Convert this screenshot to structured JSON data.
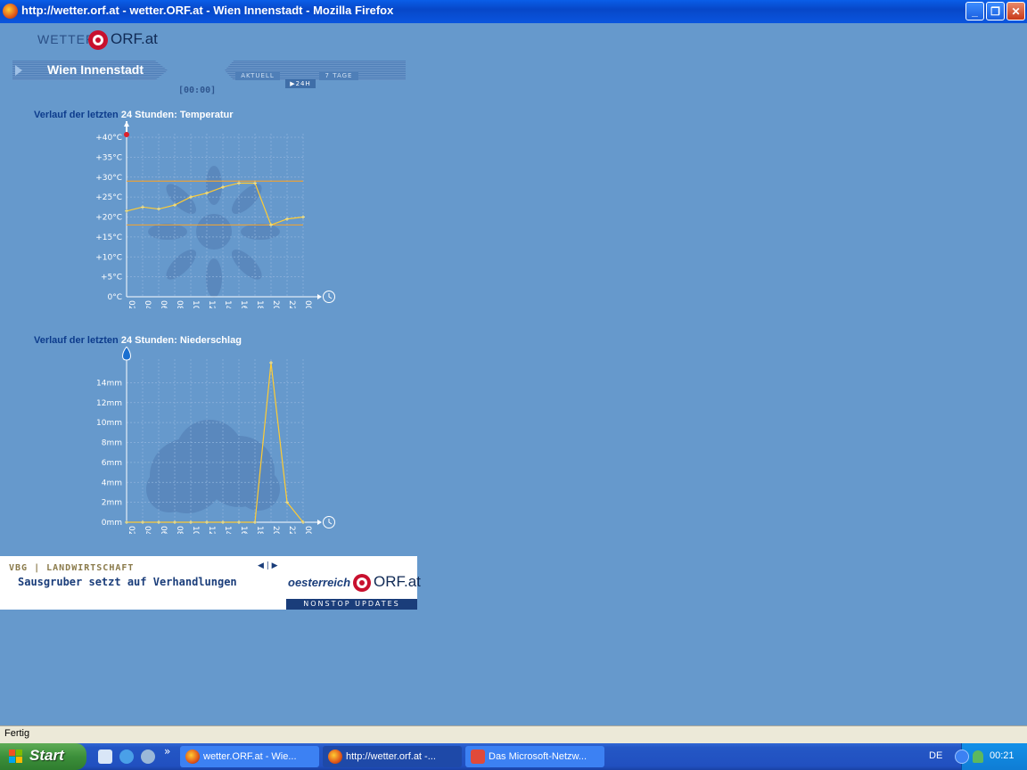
{
  "window": {
    "title": "http://wetter.orf.at - wetter.ORF.at - Wien Innenstadt - Mozilla Firefox",
    "min_glyph": "_",
    "max_glyph": "❐",
    "close_glyph": "✕"
  },
  "header": {
    "logo_wetter": "WETTER",
    "logo_orf": "ORF.at",
    "city": "Wien Innenstadt",
    "nav": {
      "aktuell": "AKTUELL",
      "h24": "▶24H",
      "tage7": "7 TAGE"
    },
    "time": "[00:00]"
  },
  "temperature": {
    "title_prefix": "Verlauf der letzten",
    "title_suffix": "24 Stunden: Temperatur"
  },
  "precipitation": {
    "title_prefix": "Verlauf der letzten",
    "title_suffix": "24 Stunden: Niederschlag"
  },
  "chart_data": [
    {
      "type": "line",
      "x": [
        "02:00",
        "04:00",
        "06:00",
        "08:00",
        "10:00",
        "12:00",
        "14:00",
        "16:00",
        "18:00",
        "20:00",
        "22:00",
        "00:00"
      ],
      "values": [
        21.5,
        22.5,
        22,
        23,
        25,
        26,
        27.5,
        28.5,
        28.5,
        18,
        19.5,
        20
      ],
      "y_tick_labels": [
        "0°C",
        "+5°C",
        "+10°C",
        "+15°C",
        "+20°C",
        "+25°C",
        "+30°C",
        "+35°C",
        "+40°C"
      ],
      "y_ticks": [
        0,
        5,
        10,
        15,
        20,
        25,
        30,
        35,
        40
      ],
      "ylim": [
        0,
        40
      ],
      "max_line": 29,
      "min_line": 18,
      "line_color": "#ffcc33"
    },
    {
      "type": "line",
      "x": [
        "02:00",
        "04:00",
        "06:00",
        "08:00",
        "10:00",
        "12:00",
        "14:00",
        "16:00",
        "18:00",
        "20:00",
        "22:00",
        "00:00"
      ],
      "values": [
        0,
        0,
        0,
        0,
        0,
        0,
        0,
        0,
        0,
        16,
        2,
        0
      ],
      "y_tick_labels": [
        "0mm",
        "2mm",
        "4mm",
        "6mm",
        "8mm",
        "10mm",
        "12mm",
        "14mm"
      ],
      "y_ticks": [
        0,
        2,
        4,
        6,
        8,
        10,
        12,
        14
      ],
      "ylim": [
        0,
        16
      ],
      "line_color": "#ffcc33"
    }
  ],
  "news": {
    "category": "VBG | LANDWIRTSCHAFT",
    "headline": "Sausgruber setzt auf Verhandlungen",
    "arrows": "◀ | ▶",
    "brand_oe": "oesterreich",
    "brand_orf": "ORF.at",
    "nonstop": "NONSTOP UPDATES"
  },
  "statusbar": {
    "text": "Fertig"
  },
  "taskbar": {
    "start": "Start",
    "chevron": "»",
    "tasks": [
      {
        "label": "wetter.ORF.at - Wie..."
      },
      {
        "label": "http://wetter.orf.at -..."
      },
      {
        "label": "Das Microsoft-Netzw..."
      }
    ],
    "lang": "DE",
    "clock": "00:21"
  }
}
